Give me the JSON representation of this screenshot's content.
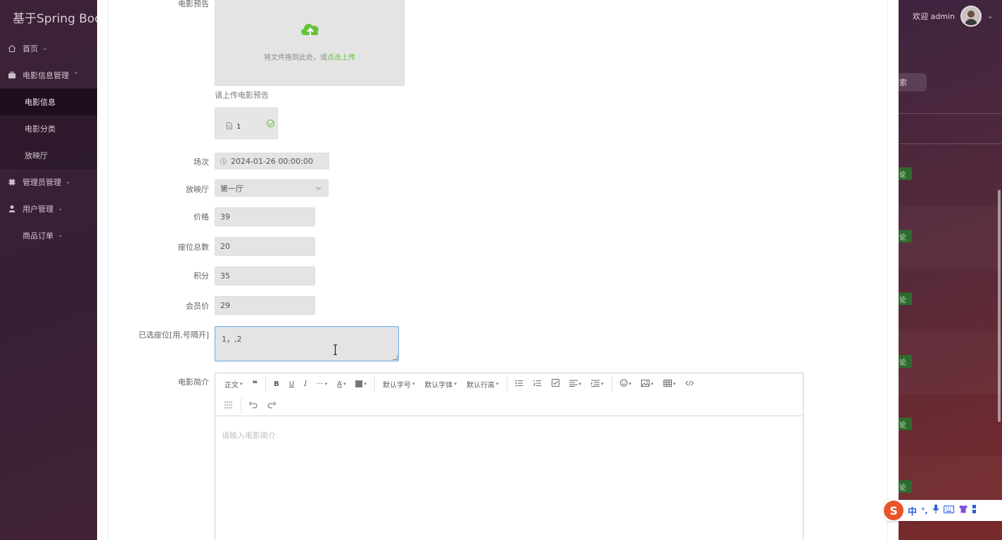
{
  "app": {
    "brand": "基于Spring Boot",
    "user_greeting": "欢迎 admin",
    "search_button": "搜索",
    "tag_text": "论"
  },
  "sidebar": {
    "items": [
      {
        "label": "首页",
        "icon": "home-icon"
      },
      {
        "label": "电影信息管理",
        "icon": "briefcase-icon"
      },
      {
        "label": "管理员管理",
        "icon": "cpu-icon"
      },
      {
        "label": "用户管理",
        "icon": "user-icon"
      },
      {
        "label": "商品订单",
        "icon": "none"
      }
    ],
    "submenu": [
      {
        "label": "电影信息",
        "active": true
      },
      {
        "label": "电影分类",
        "active": false
      },
      {
        "label": "放映厅",
        "active": false
      }
    ]
  },
  "form": {
    "trailer": {
      "label": "电影预告",
      "drag_text": "将文件拖到此处，或",
      "click_text": "点击上传",
      "tip": "请上传电影预告",
      "file_name": "1"
    },
    "session": {
      "label": "场次",
      "value": "2024-01-26 00:00:00"
    },
    "hall": {
      "label": "放映厅",
      "value": "第一厅"
    },
    "price": {
      "label": "价格",
      "value": "39"
    },
    "seats_total": {
      "label": "座位总数",
      "value": "20"
    },
    "points": {
      "label": "积分",
      "value": "35"
    },
    "member_price": {
      "label": "会员价",
      "value": "29"
    },
    "selected_seats": {
      "label": "已选座位[用,号隔开]",
      "value": "1，,2"
    },
    "intro": {
      "label": "电影简介",
      "placeholder": "请输入电影简介"
    }
  },
  "editor_toolbar": {
    "paragraph": "正文",
    "font_size": "默认字号",
    "font_family": "默认字体",
    "line_height": "默认行高",
    "more": "···",
    "font_color": "A"
  },
  "ime": {
    "lang": "中",
    "punct": "°,"
  },
  "colors": {
    "accent_green": "#67c23a",
    "focus_blue": "#6aa8e8",
    "tag_green": "#2f6a2e"
  }
}
